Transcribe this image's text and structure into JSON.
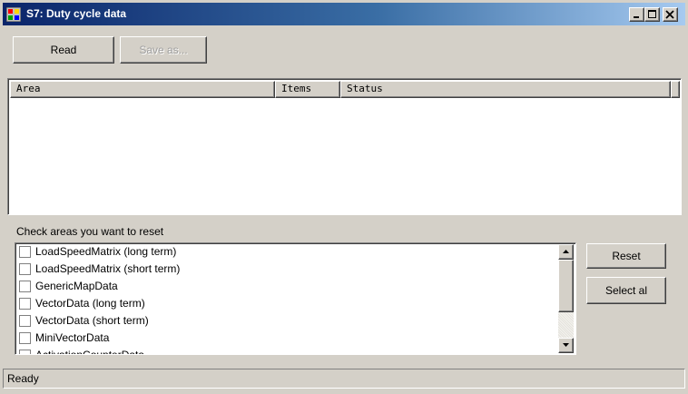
{
  "window": {
    "title": "S7: Duty cycle data",
    "icon": "app-window-icon",
    "controls": {
      "minimize": "minimize-icon",
      "maximize": "maximize-icon",
      "close": "close-icon"
    }
  },
  "toolbar": {
    "read_label": "Read",
    "saveas_label": "Save as...",
    "saveas_enabled": false
  },
  "listview": {
    "columns": [
      "Area",
      "Items",
      "Status"
    ],
    "rows": []
  },
  "reset_section": {
    "label": "Check areas you want to reset",
    "items": [
      {
        "label": "LoadSpeedMatrix (long term)",
        "checked": false
      },
      {
        "label": "LoadSpeedMatrix (short term)",
        "checked": false
      },
      {
        "label": "GenericMapData",
        "checked": false
      },
      {
        "label": "VectorData (long term)",
        "checked": false
      },
      {
        "label": "VectorData (short term)",
        "checked": false
      },
      {
        "label": "MiniVectorData",
        "checked": false
      },
      {
        "label": "ActivationCounterData",
        "checked": false
      }
    ],
    "reset_label": "Reset",
    "selectall_label": "Select al"
  },
  "statusbar": {
    "text": "Ready"
  },
  "colors": {
    "face": "#d4d0c8",
    "title_start": "#0a246a",
    "title_end": "#a6caf0",
    "disabled_text": "#a0a0a0"
  }
}
